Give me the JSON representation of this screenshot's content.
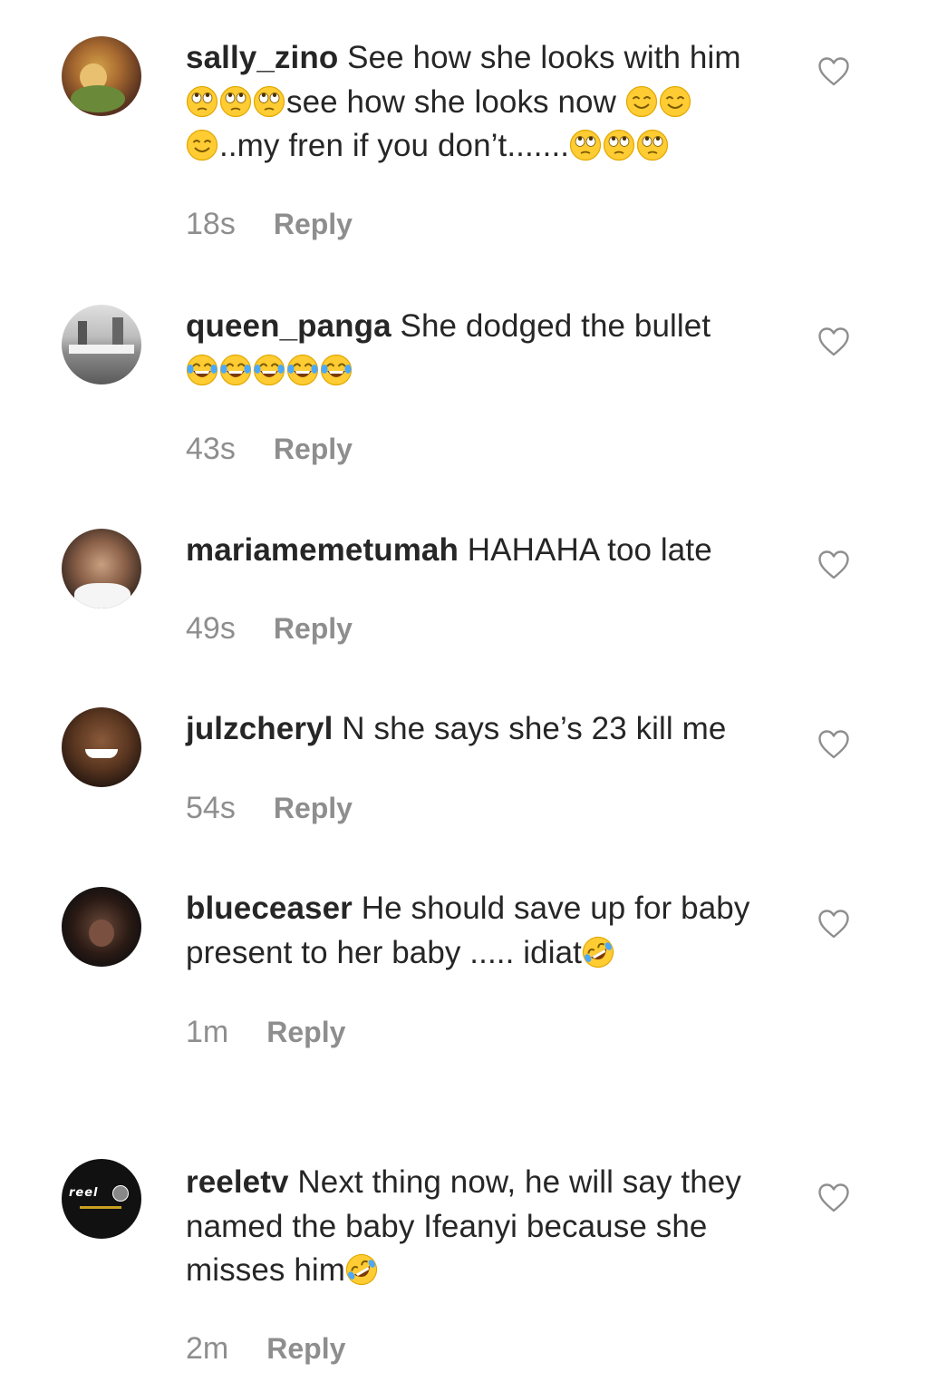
{
  "comments": [
    {
      "user": "sally_zino",
      "line1": "See how she looks with him",
      "line2": "see how she looks now",
      "line3": "..my fren if you don’t.......",
      "time": "18s",
      "reply": "Reply",
      "emoji_names": [
        "face-with-rolling-eyes-emoji",
        "smiling-face-emoji"
      ]
    },
    {
      "user": "queen_panga",
      "line1": "She dodged the bullet",
      "time": "43s",
      "reply": "Reply",
      "emoji_names": [
        "face-with-tears-of-joy-emoji"
      ]
    },
    {
      "user": "mariamemetumah",
      "line1": "HAHAHA too late",
      "time": "49s",
      "reply": "Reply"
    },
    {
      "user": "julzcheryl",
      "line1": "N she says she’s 23 kill me",
      "time": "54s",
      "reply": "Reply"
    },
    {
      "user": "blueceaser",
      "line1": "He should save up for baby",
      "line2": "present to her baby ..... idiat",
      "time": "1m",
      "reply": "Reply",
      "emoji_names": [
        "rolling-on-floor-laughing-emoji"
      ]
    },
    {
      "user": "reeletv",
      "line1": "Next thing now, he will say they",
      "line2": "named the baby Ifeanyi because she",
      "line3": "misses him",
      "time": "2m",
      "reply": "Reply",
      "emoji_names": [
        "rolling-on-floor-laughing-emoji"
      ],
      "avatar_text": "reel"
    }
  ],
  "colors": {
    "text": "#262626",
    "meta": "#8e8e8e",
    "emoji": "#ffcc33",
    "background": "#ffffff"
  },
  "icons": {
    "like": "heart-outline-icon"
  }
}
